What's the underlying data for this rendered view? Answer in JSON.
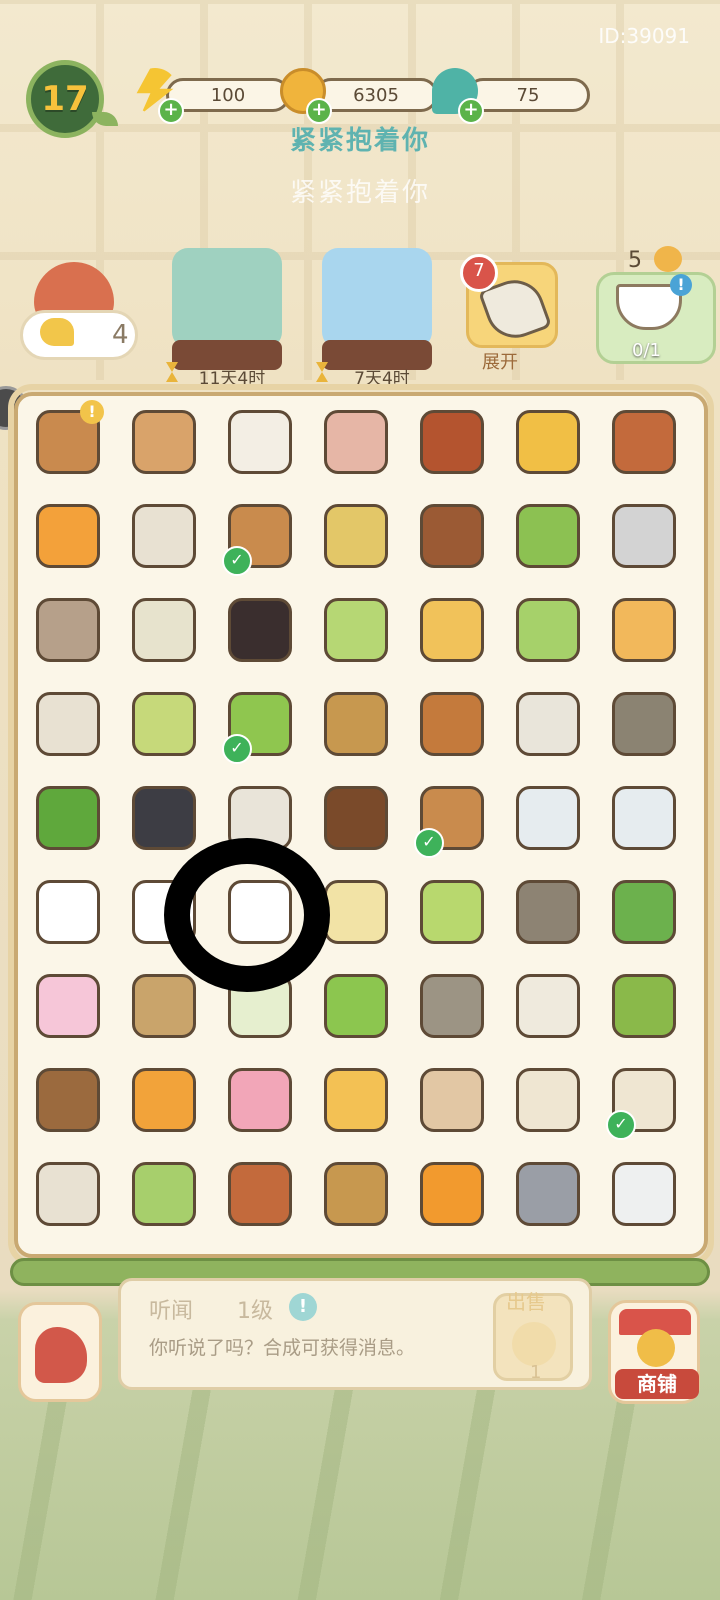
{
  "player": {
    "id_text": "ID:39091",
    "level": "17"
  },
  "resources": [
    {
      "name": "energy",
      "value": "100",
      "icon": "lightning-icon",
      "color": "#f5c533"
    },
    {
      "name": "coins",
      "value": "6305",
      "icon": "coin-icon",
      "color": "#f0b43c"
    },
    {
      "name": "gems",
      "value": "75",
      "icon": "jade-drop-icon",
      "color": "#4fb3a6"
    }
  ],
  "titles": {
    "main": "紧紧抱着你",
    "sub": "紧紧抱着你"
  },
  "panda": {
    "count": "4"
  },
  "events": [
    {
      "name": "red-panda-tea-event",
      "time": "11天4时",
      "color": "#9fd1c0"
    },
    {
      "name": "snow-bear-event",
      "time": "7天4时",
      "color": "#a9d6ee"
    }
  ],
  "seed_bag": {
    "badge": "7",
    "label": "展开"
  },
  "tea_task": {
    "count": "5",
    "progress": "0/1"
  },
  "board": {
    "rows": [
      [
        {
          "item": "pagoda-house",
          "color": "#c98a4e",
          "alert": true
        },
        {
          "item": "pipa-lute",
          "color": "#d9a36a"
        },
        {
          "item": "music-sheets",
          "color": "#f3eee4"
        },
        {
          "item": "red-paper",
          "color": "#e6b6a6"
        },
        {
          "item": "ink-stick",
          "color": "#b4542f"
        },
        {
          "item": "golden-lion",
          "color": "#f1bf45"
        },
        {
          "item": "pan-flute",
          "color": "#c36a3c"
        }
      ],
      [
        {
          "item": "lantern",
          "color": "#f3a13a"
        },
        {
          "item": "paper-kite",
          "color": "#e8e1d2"
        },
        {
          "item": "woven-mat",
          "color": "#c98b4d",
          "check": true
        },
        {
          "item": "pebbles",
          "color": "#e3c768"
        },
        {
          "item": "fire-brazier",
          "color": "#9b5a34"
        },
        {
          "item": "sprout",
          "color": "#8cc152"
        },
        {
          "item": "stone-ring",
          "color": "#d3d3d3"
        }
      ],
      [
        {
          "item": "owl",
          "color": "#b6a08a"
        },
        {
          "item": "flat-stone",
          "color": "#e7e3cd"
        },
        {
          "item": "lacquer-box",
          "color": "#3a2e2e"
        },
        {
          "item": "green-bean",
          "color": "#b6d774"
        },
        {
          "item": "bamboo-slips",
          "color": "#f1c25a"
        },
        {
          "item": "seedling",
          "color": "#a6d16a"
        },
        {
          "item": "basket-pole",
          "color": "#f2b85b"
        }
      ],
      [
        {
          "item": "paper-kite",
          "color": "#e8e1d2"
        },
        {
          "item": "green-sprout-bud",
          "color": "#c6d97a"
        },
        {
          "item": "matcha-jar",
          "color": "#8fc64f",
          "check": true
        },
        {
          "item": "bamboo-frame",
          "color": "#c7984f"
        },
        {
          "item": "bamboo-flute",
          "color": "#c47a3c"
        },
        {
          "item": "tied-parcel",
          "color": "#e9e5da"
        },
        {
          "item": "stone-cube",
          "color": "#8b8372"
        }
      ],
      [
        {
          "item": "bamboo-leaves",
          "color": "#5fa83c"
        },
        {
          "item": "black-cloth",
          "color": "#3d3d44"
        },
        {
          "item": "dumplings",
          "color": "#e9e4d9"
        },
        {
          "item": "tea-leaves",
          "color": "#7a4a2a"
        },
        {
          "item": "woven-mat",
          "color": "#c98b4d",
          "check": true
        },
        {
          "item": "teapot",
          "color": "#e6ecef"
        },
        {
          "item": "fancy-teapot",
          "color": "#e6ecef"
        }
      ],
      [
        {
          "item": "speech-bubbles-alert",
          "color": "#ffffff"
        },
        {
          "item": "speech-bubble",
          "color": "#ffffff"
        },
        {
          "item": "speech-bubbles",
          "color": "#ffffff"
        },
        {
          "item": "tea-bowl-ginkgo",
          "color": "#f2e3a6"
        },
        {
          "item": "green-tea-cup",
          "color": "#b8d86e"
        },
        {
          "item": "wooden-planks",
          "color": "#8d8373"
        },
        {
          "item": "bamboo-cross",
          "color": "#6cb14d"
        }
      ],
      [
        {
          "item": "pink-towel",
          "color": "#f6c6d8"
        },
        {
          "item": "signboard",
          "color": "#c9a46b"
        },
        {
          "item": "firefly",
          "color": "#e6efcf"
        },
        {
          "item": "bamboo-cup",
          "color": "#8cc64f"
        },
        {
          "item": "stone-slab",
          "color": "#9c9484"
        },
        {
          "item": "seed-bag",
          "color": "#efeadd"
        },
        {
          "item": "bonsai-tree",
          "color": "#8ab94a"
        }
      ],
      [
        {
          "item": "log-stump",
          "color": "#9b6a3e"
        },
        {
          "item": "campfire",
          "color": "#f2a33a"
        },
        {
          "item": "butterfly",
          "color": "#f2a6b8"
        },
        {
          "item": "hedgehog",
          "color": "#f3c154"
        },
        {
          "item": "hamster",
          "color": "#e2c7a4"
        },
        {
          "item": "stone-cat",
          "color": "#efe6d2"
        },
        {
          "item": "stone-cat",
          "color": "#efe6d2",
          "check": true
        }
      ],
      [
        {
          "item": "paper-kite",
          "color": "#e8e1d2"
        },
        {
          "item": "bamboo-shoot",
          "color": "#a7cf6c"
        },
        {
          "item": "pan-flute",
          "color": "#c36a3c"
        },
        {
          "item": "bamboo-frame",
          "color": "#c7984f"
        },
        {
          "item": "orange-candle",
          "color": "#f29a2e"
        },
        {
          "item": "incense-burner",
          "color": "#9a9ea6"
        },
        {
          "item": "milk-pitcher",
          "color": "#eef0f0"
        }
      ]
    ]
  },
  "selected_item": {
    "name": "听闻",
    "level": "1级",
    "description": "你听说了吗？合成可获得消息。",
    "sell_label": "出售",
    "sell_price": "1"
  },
  "shop": {
    "label": "商铺"
  }
}
